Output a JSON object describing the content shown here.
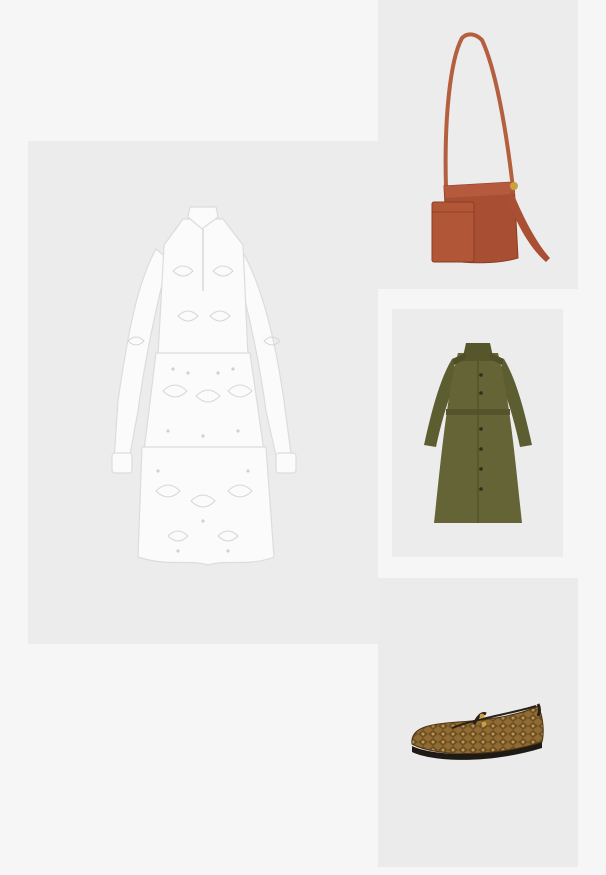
{
  "outfit_grid": {
    "background": "#f6f6f6",
    "tile_background": "#ececec",
    "items": [
      {
        "id": "dress",
        "icon": "dress-product-image",
        "color": "#ffffff"
      },
      {
        "id": "bag",
        "icon": "bucket-bag-product-image",
        "color": "#a94f33"
      },
      {
        "id": "coat",
        "icon": "trench-coat-product-image",
        "color": "#5f5f32"
      },
      {
        "id": "shoe",
        "icon": "snakeskin-flat-product-image",
        "color": "#8a6a33"
      }
    ]
  }
}
